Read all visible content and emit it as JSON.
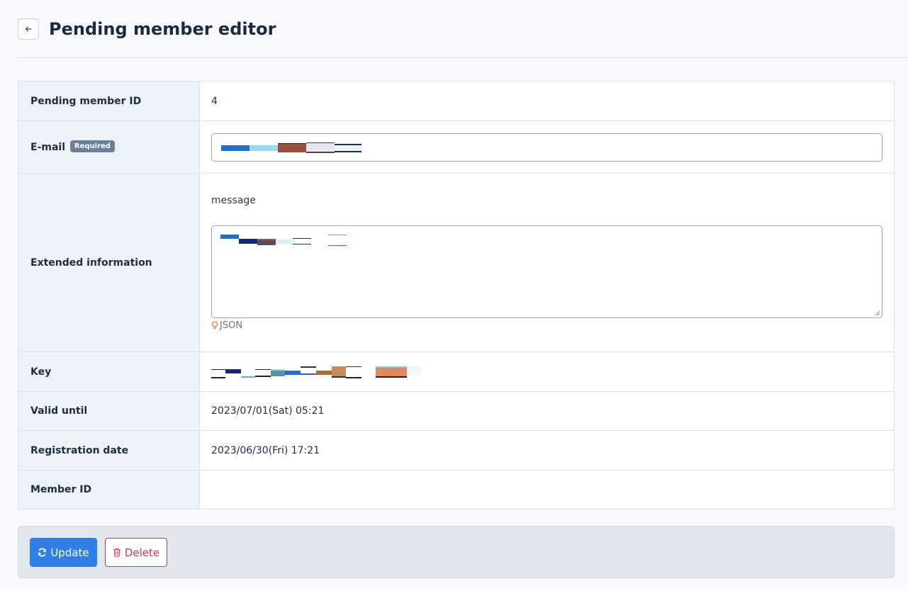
{
  "header": {
    "back_icon": "arrow-left-icon",
    "title": "Pending member editor"
  },
  "form": {
    "rows": {
      "pending_member_id": {
        "label": "Pending member ID",
        "value": "4"
      },
      "email": {
        "label": "E-mail",
        "badge": "Required",
        "value": ""
      },
      "extended_information": {
        "label": "Extended information",
        "field_label": "message",
        "value": "",
        "hint_icon": "lightbulb-icon",
        "hint": "JSON"
      },
      "key": {
        "label": "Key",
        "value": ""
      },
      "valid_until": {
        "label": "Valid until",
        "value": "2023/07/01(Sat) 05:21"
      },
      "registration_date": {
        "label": "Registration date",
        "value": "2023/06/30(Fri) 17:21"
      },
      "member_id": {
        "label": "Member ID",
        "value": ""
      }
    }
  },
  "actions": {
    "update_label": "Update",
    "update_icon": "refresh-icon",
    "delete_label": "Delete",
    "delete_icon": "trash-icon"
  },
  "colors": {
    "accent": "#2f7fe6",
    "danger": "#d1394d",
    "badge": "#6c7f96",
    "label_bg": "#edf2f8"
  }
}
